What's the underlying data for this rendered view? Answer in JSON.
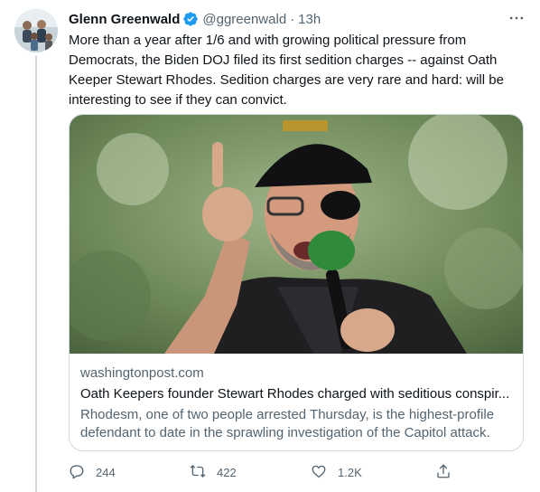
{
  "author": {
    "name": "Glenn Greenwald",
    "handle": "@ggreenwald",
    "time": "13h",
    "verified_color": "#1d9bf0"
  },
  "tweet_text": "More than a year after 1/6 and with growing political pressure from Democrats, the Biden DOJ filed its first sedition charges -- against Oath Keeper Stewart Rhodes. Sedition charges are very rare and hard: will be interesting to see if they can convict.",
  "card": {
    "domain": "washingtonpost.com",
    "title": "Oath Keepers founder Stewart Rhodes charged with seditious conspir...",
    "description": "Rhodesm, one of two people arrested Thursday, is the highest-profile defendant to date in the sprawling investigation of the Capitol attack.",
    "image_label": "news-photo"
  },
  "actions": {
    "replies": "244",
    "retweets": "422",
    "likes": "1.2K"
  },
  "icons": [
    "verified-icon",
    "more-icon",
    "reply-icon",
    "retweet-icon",
    "like-icon",
    "share-icon"
  ]
}
